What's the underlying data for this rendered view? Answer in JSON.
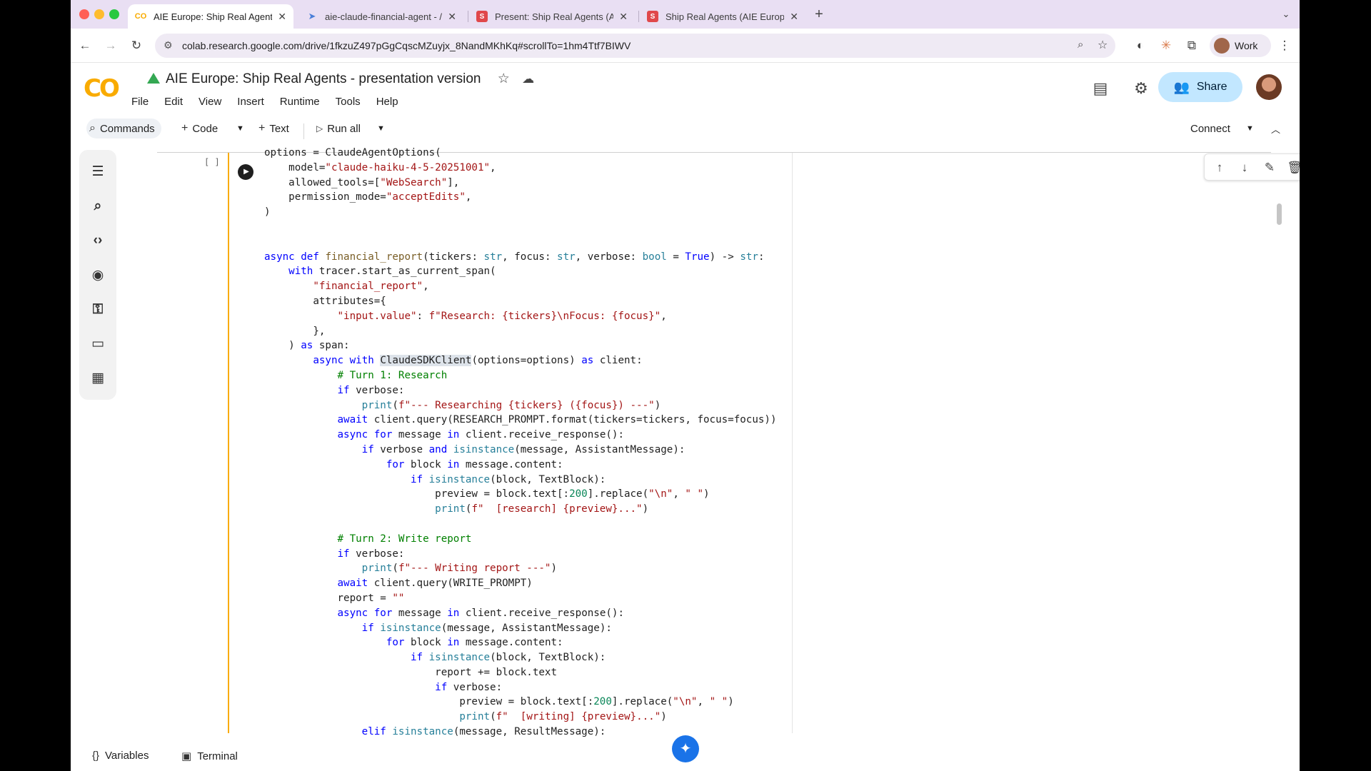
{
  "tabs": [
    {
      "title": "AIE Europe: Ship Real Agents",
      "favicon": "CO",
      "active": true
    },
    {
      "title": "aie-claude-financial-agent - /",
      "favicon": "send",
      "active": false
    },
    {
      "title": "Present: Ship Real Agents (AI",
      "favicon": "S",
      "active": false
    },
    {
      "title": "Ship Real Agents (AIE Europe",
      "favicon": "S",
      "active": false
    }
  ],
  "address": {
    "url": "colab.research.google.com/drive/1fkzuZ497pGgCqscMZuyjx_8NandMKhKq#scrollTo=1hm4Ttf7BIWV",
    "profile": "Work"
  },
  "notebook": {
    "logo": "CO",
    "title": "AIE Europe: Ship Real Agents - presentation version",
    "menu": [
      "File",
      "Edit",
      "View",
      "Insert",
      "Runtime",
      "Tools",
      "Help"
    ],
    "share_label": "Share"
  },
  "toolbar": {
    "commands": "Commands",
    "code": "Code",
    "text": "Text",
    "run_all": "Run all",
    "connect": "Connect"
  },
  "cell": {
    "exec_count": "[ ]",
    "lines": [
      "options = ClaudeAgentOptions(",
      "    model=\"claude-haiku-4-5-20251001\",",
      "    allowed_tools=[\"WebSearch\"],",
      "    permission_mode=\"acceptEdits\",",
      ")",
      "",
      "",
      "async def financial_report(tickers: str, focus: str, verbose: bool = True) -> str:",
      "    with tracer.start_as_current_span(",
      "        \"financial_report\",",
      "        attributes={",
      "            \"input.value\": f\"Research: {tickers}\\nFocus: {focus}\",",
      "        },",
      "    ) as span:",
      "        async with ClaudeSDKClient(options=options) as client:",
      "            # Turn 1: Research",
      "            if verbose:",
      "                print(f\"--- Researching {tickers} ({focus}) ---\")",
      "            await client.query(RESEARCH_PROMPT.format(tickers=tickers, focus=focus))",
      "            async for message in client.receive_response():",
      "                if verbose and isinstance(message, AssistantMessage):",
      "                    for block in message.content:",
      "                        if isinstance(block, TextBlock):",
      "                            preview = block.text[:200].replace(\"\\n\", \" \")",
      "                            print(f\"  [research] {preview}...\")",
      "",
      "            # Turn 2: Write report",
      "            if verbose:",
      "                print(f\"--- Writing report ---\")",
      "            await client.query(WRITE_PROMPT)",
      "            report = \"\"",
      "            async for message in client.receive_response():",
      "                if isinstance(message, AssistantMessage):",
      "                    for block in message.content:",
      "                        if isinstance(block, TextBlock):",
      "                            report += block.text",
      "                            if verbose:",
      "                                preview = block.text[:200].replace(\"\\n\", \" \")",
      "                                print(f\"  [writing] {preview}...\")",
      "                elif isinstance(message, ResultMessage):"
    ]
  },
  "bottom": {
    "variables": "Variables",
    "terminal": "Terminal"
  },
  "colors": {
    "tabstrip": "#e9dff3",
    "share": "#c2e7ff",
    "cell_focus": "#f9ab00",
    "keyword": "#0000ff",
    "string": "#a31515",
    "comment": "#008000"
  }
}
